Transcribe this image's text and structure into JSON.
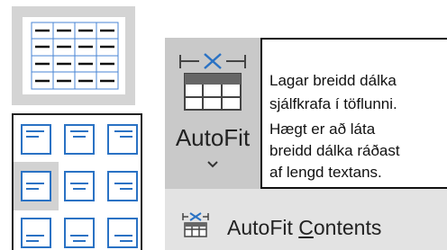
{
  "autofit": {
    "label": "AutoFit",
    "icon": "autofit-table-icon"
  },
  "tooltip": {
    "lines": [
      "Lagar breidd dálka",
      "sjálfkrafa í töflunni.",
      "Hægt er að láta",
      "breidd dálka ráðast",
      "af lengd textans."
    ]
  },
  "menu": {
    "item_label_prefix": "AutoFit ",
    "item_label_accel": "C",
    "item_label_rest": "ontents",
    "icon": "autofit-contents-icon"
  },
  "colors": {
    "accent_blue": "#2a72c4",
    "ribbon_gray": "#e3e3e3",
    "button_gray": "#c9c9c9"
  }
}
